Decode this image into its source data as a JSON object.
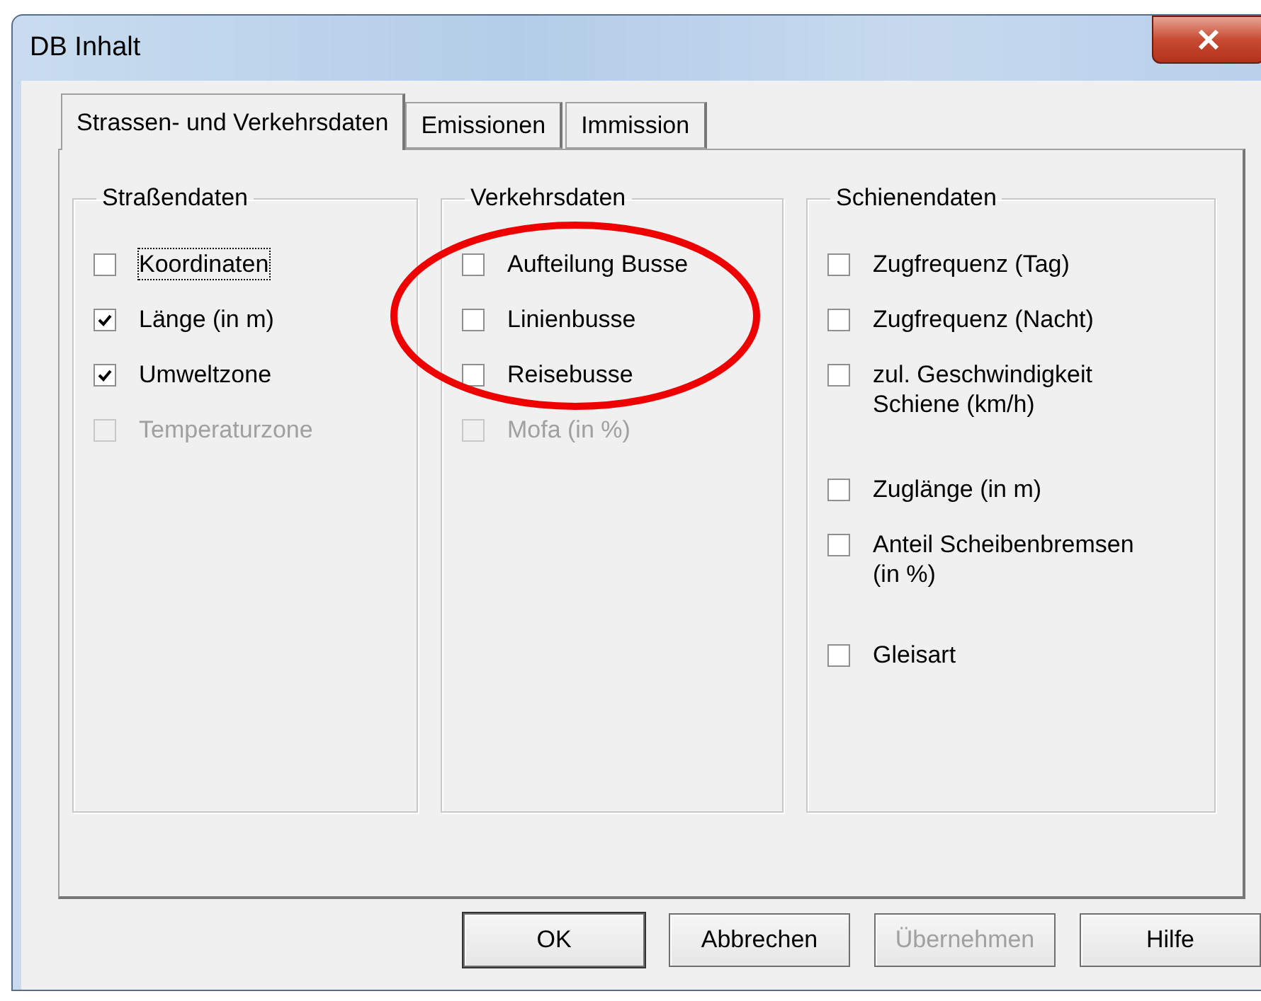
{
  "window": {
    "title": "DB Inhalt"
  },
  "tabs": [
    {
      "label": "Strassen- und Verkehrsdaten",
      "selected": true
    },
    {
      "label": "Emissionen",
      "selected": false
    },
    {
      "label": "Immission",
      "selected": false
    }
  ],
  "groups": [
    {
      "title": "Straßendaten",
      "items": [
        {
          "label": "Koordinaten",
          "checked": false,
          "disabled": false,
          "focused": true
        },
        {
          "label": "Länge (in m)",
          "checked": true,
          "disabled": false,
          "focused": false
        },
        {
          "label": "Umweltzone",
          "checked": true,
          "disabled": false,
          "focused": false
        },
        {
          "label": "Temperaturzone",
          "checked": false,
          "disabled": true,
          "focused": false
        }
      ]
    },
    {
      "title": "Verkehrsdaten",
      "items": [
        {
          "label": "Aufteilung Busse",
          "checked": false,
          "disabled": false,
          "focused": false
        },
        {
          "label": "Linienbusse",
          "checked": false,
          "disabled": false,
          "focused": false
        },
        {
          "label": "Reisebusse",
          "checked": false,
          "disabled": false,
          "focused": false
        },
        {
          "label": "Mofa (in %)",
          "checked": false,
          "disabled": true,
          "focused": false
        }
      ]
    },
    {
      "title": "Schienendaten",
      "items": [
        {
          "label": "Zugfrequenz (Tag)",
          "checked": false,
          "disabled": false,
          "focused": false
        },
        {
          "label": "Zugfrequenz (Nacht)",
          "checked": false,
          "disabled": false,
          "focused": false
        },
        {
          "label": "zul. Geschwindigkeit Schiene (km/h)",
          "checked": false,
          "disabled": false,
          "focused": false
        },
        {
          "label": "Zuglänge (in m)",
          "checked": false,
          "disabled": false,
          "focused": false
        },
        {
          "label": "Anteil Scheibenbremsen (in %)",
          "checked": false,
          "disabled": false,
          "focused": false
        },
        {
          "label": "Gleisart",
          "checked": false,
          "disabled": false,
          "focused": false
        }
      ]
    }
  ],
  "buttons": [
    {
      "label": "OK",
      "disabled": false,
      "default": true
    },
    {
      "label": "Abbrechen",
      "disabled": false,
      "default": false
    },
    {
      "label": "Übernehmen",
      "disabled": true,
      "default": false
    },
    {
      "label": "Hilfe",
      "disabled": false,
      "default": false
    }
  ]
}
